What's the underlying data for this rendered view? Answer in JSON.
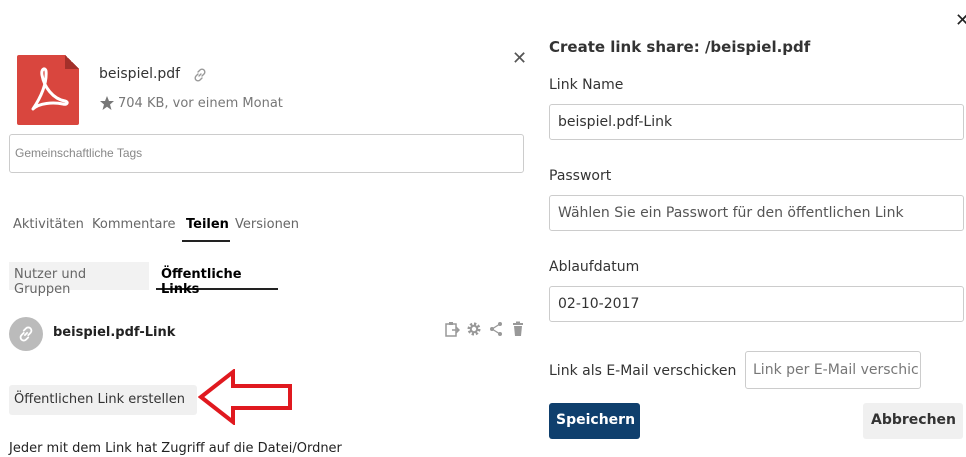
{
  "file": {
    "name": "beispiel.pdf",
    "meta": "704 KB, vor einem Monat",
    "icon": "pdf-file-icon"
  },
  "tags": {
    "placeholder": "Gemeinschaftliche Tags"
  },
  "tabs": [
    {
      "label": "Aktivitäten",
      "active": false
    },
    {
      "label": "Kommentare",
      "active": false
    },
    {
      "label": "Teilen",
      "active": true
    },
    {
      "label": "Versionen",
      "active": false
    }
  ],
  "subtabs": [
    {
      "label": "Nutzer und Gruppen",
      "active": false
    },
    {
      "label": "Öffentliche Links",
      "active": true
    }
  ],
  "share": {
    "name": "beispiel.pdf-Link"
  },
  "create_link_button": "Öffentlichen Link erstellen",
  "footnote": "Jeder mit dem Link hat Zugriff auf die Datei/Ordner",
  "dialog": {
    "title": "Create link share: /beispiel.pdf",
    "link_name_label": "Link Name",
    "link_name_value": "beispiel.pdf-Link",
    "password_label": "Passwort",
    "password_placeholder": "Wählen Sie ein Passwort für den öffentlichen Link",
    "expiry_label": "Ablaufdatum",
    "expiry_value": "02-10-2017",
    "email_label": "Link als E-Mail verschicken",
    "email_placeholder": "Link per E-Mail verschicken",
    "save_label": "Speichern",
    "cancel_label": "Abbrechen"
  },
  "colors": {
    "accent": "#0f3f6d",
    "pdf": "#d9463e",
    "annotation_arrow": "#e0191f"
  }
}
